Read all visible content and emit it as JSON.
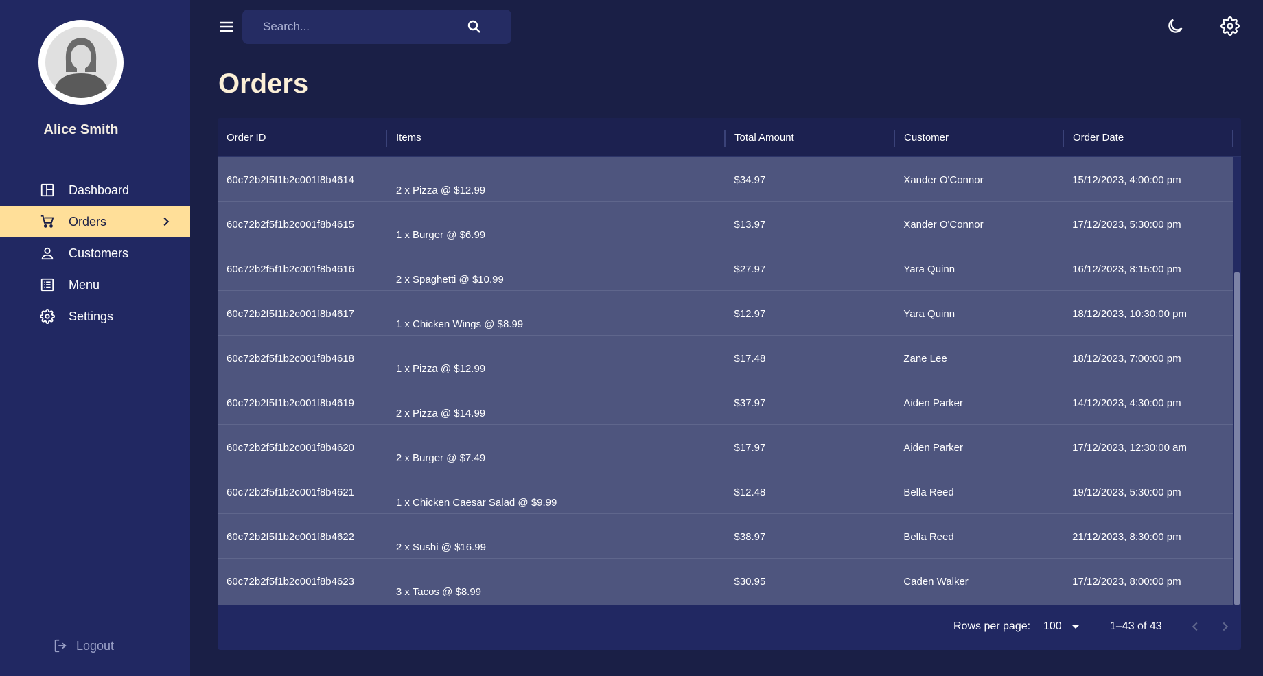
{
  "user": {
    "name": "Alice Smith"
  },
  "nav": {
    "items": [
      {
        "label": "Dashboard",
        "icon": "dashboard-icon"
      },
      {
        "label": "Orders",
        "icon": "cart-icon",
        "active": true
      },
      {
        "label": "Customers",
        "icon": "person-icon"
      },
      {
        "label": "Menu",
        "icon": "list-icon"
      },
      {
        "label": "Settings",
        "icon": "gear-icon"
      }
    ],
    "logout_label": "Logout"
  },
  "search": {
    "placeholder": "Search..."
  },
  "page": {
    "title": "Orders"
  },
  "table": {
    "columns": [
      "Order ID",
      "Items",
      "Total Amount",
      "Customer",
      "Order Date"
    ],
    "rows": [
      {
        "id": "60c72b2f5f1b2c001f8b4614",
        "items": "2 x Pizza @ $12.99",
        "total": "$34.97",
        "customer": "Xander O'Connor",
        "date": "15/12/2023, 4:00:00 pm"
      },
      {
        "id": "60c72b2f5f1b2c001f8b4615",
        "items": "1 x Burger @ $6.99",
        "total": "$13.97",
        "customer": "Xander O'Connor",
        "date": "17/12/2023, 5:30:00 pm"
      },
      {
        "id": "60c72b2f5f1b2c001f8b4616",
        "items": "2 x Spaghetti @ $10.99",
        "total": "$27.97",
        "customer": "Yara Quinn",
        "date": "16/12/2023, 8:15:00 pm"
      },
      {
        "id": "60c72b2f5f1b2c001f8b4617",
        "items": "1 x Chicken Wings @ $8.99",
        "total": "$12.97",
        "customer": "Yara Quinn",
        "date": "18/12/2023, 10:30:00 pm"
      },
      {
        "id": "60c72b2f5f1b2c001f8b4618",
        "items": "1 x Pizza @ $12.99",
        "total": "$17.48",
        "customer": "Zane Lee",
        "date": "18/12/2023, 7:00:00 pm"
      },
      {
        "id": "60c72b2f5f1b2c001f8b4619",
        "items": "2 x Pizza @ $14.99",
        "total": "$37.97",
        "customer": "Aiden Parker",
        "date": "14/12/2023, 4:30:00 pm"
      },
      {
        "id": "60c72b2f5f1b2c001f8b4620",
        "items": "2 x Burger @ $7.49",
        "total": "$17.97",
        "customer": "Aiden Parker",
        "date": "17/12/2023, 12:30:00 am"
      },
      {
        "id": "60c72b2f5f1b2c001f8b4621",
        "items": "1 x Chicken Caesar Salad @ $9.99",
        "total": "$12.48",
        "customer": "Bella Reed",
        "date": "19/12/2023, 5:30:00 pm"
      },
      {
        "id": "60c72b2f5f1b2c001f8b4622",
        "items": "2 x Sushi @ $16.99",
        "total": "$38.97",
        "customer": "Bella Reed",
        "date": "21/12/2023, 8:30:00 pm"
      },
      {
        "id": "60c72b2f5f1b2c001f8b4623",
        "items": "3 x Tacos @ $8.99",
        "total": "$30.95",
        "customer": "Caden Walker",
        "date": "17/12/2023, 8:00:00 pm"
      }
    ]
  },
  "pagination": {
    "rows_per_page_label": "Rows per page:",
    "rows_per_page_value": "100",
    "range_label": "1–43 of 43"
  },
  "colors": {
    "background": "#1a1f46",
    "sidebar": "#212862",
    "accent": "#ffdf99",
    "row": "#4e557e",
    "title": "#fbefd7"
  }
}
